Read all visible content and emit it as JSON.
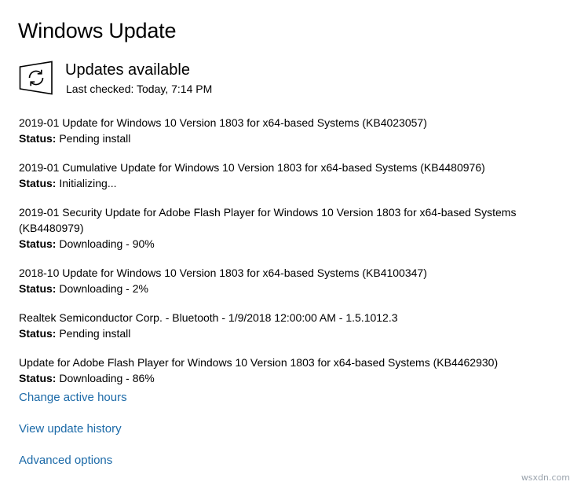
{
  "page": {
    "title": "Windows Update"
  },
  "status": {
    "icon": "sync-refresh-icon",
    "title": "Updates available",
    "last_checked": "Last checked: Today, 7:14 PM"
  },
  "updates": [
    {
      "name": "2019-01 Update for Windows 10 Version 1803 for x64-based Systems (KB4023057)",
      "status_label": "Status:",
      "status_value": "Pending install"
    },
    {
      "name": "2019-01 Cumulative Update for Windows 10 Version 1803 for x64-based Systems (KB4480976)",
      "status_label": "Status:",
      "status_value": "Initializing..."
    },
    {
      "name": "2019-01 Security Update for Adobe Flash Player for Windows 10 Version 1803 for x64-based Systems (KB4480979)",
      "status_label": "Status:",
      "status_value": "Downloading - 90%"
    },
    {
      "name": "2018-10 Update for Windows 10 Version 1803 for x64-based Systems (KB4100347)",
      "status_label": "Status:",
      "status_value": "Downloading - 2%"
    },
    {
      "name": "Realtek Semiconductor Corp. - Bluetooth - 1/9/2018 12:00:00 AM - 1.5.1012.3",
      "status_label": "Status:",
      "status_value": "Pending install"
    },
    {
      "name": "Update for Adobe Flash Player for Windows 10 Version 1803 for x64-based Systems (KB4462930)",
      "status_label": "Status:",
      "status_value": "Downloading - 86%"
    }
  ],
  "links": {
    "active_hours": "Change active hours",
    "history": "View update history",
    "advanced": "Advanced options"
  },
  "watermark": "wsxdn.com",
  "colors": {
    "link": "#1c6aa8",
    "text": "#000000",
    "background": "#ffffff"
  }
}
